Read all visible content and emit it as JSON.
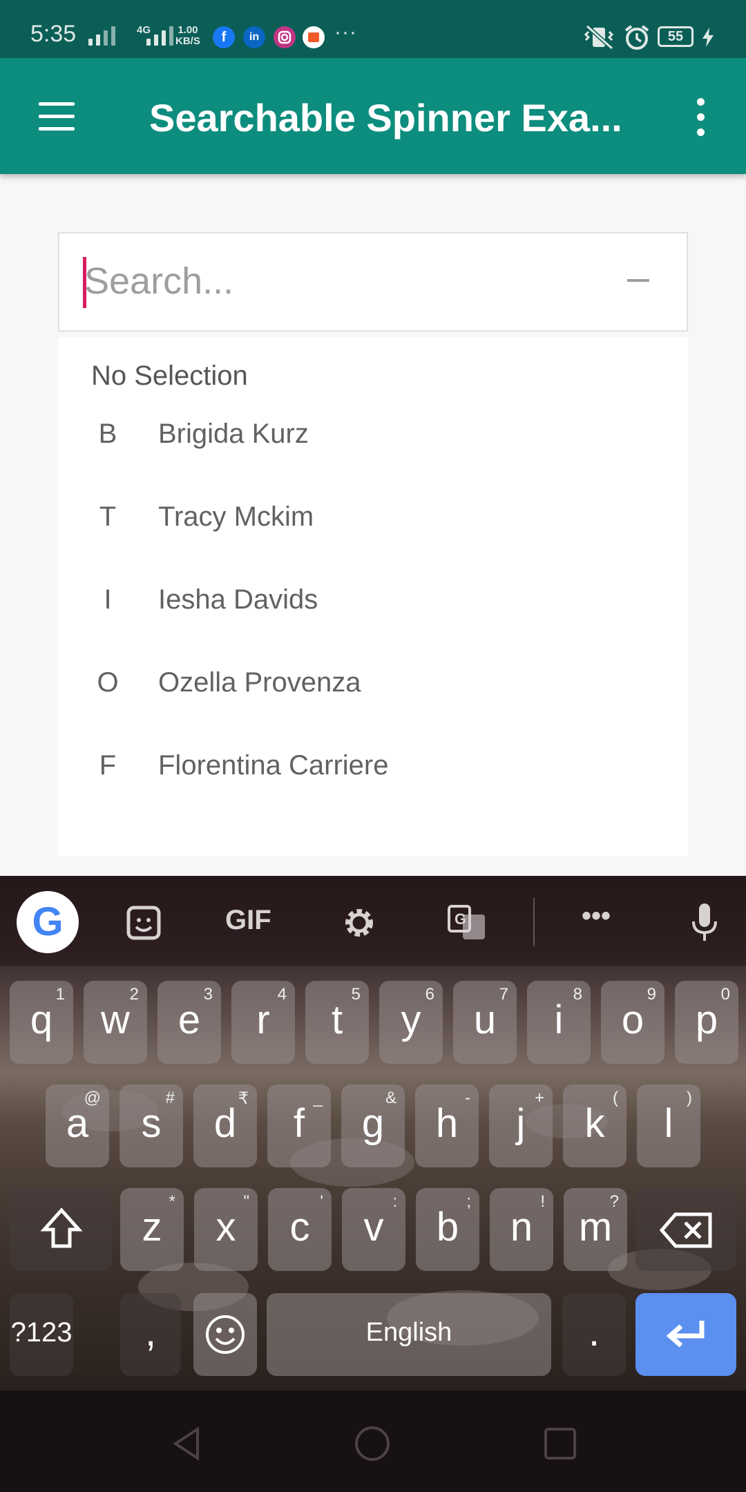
{
  "status_bar": {
    "time": "5:35",
    "network": "4G",
    "speed_value": "1.00",
    "speed_unit": "KB/S",
    "more_notifications": "···",
    "battery_level": "55",
    "app_icons": [
      "facebook-icon",
      "linkedin-icon",
      "instagram-icon",
      "news-icon"
    ]
  },
  "toolbar": {
    "title": "Searchable Spinner Exa...",
    "background": "#0d8d7e"
  },
  "search": {
    "placeholder": "Search...",
    "value": ""
  },
  "list": {
    "no_selection": "No Selection",
    "items": [
      {
        "initial": "B",
        "name": "Brigida Kurz"
      },
      {
        "initial": "T",
        "name": "Tracy Mckim"
      },
      {
        "initial": "I",
        "name": "Iesha Davids"
      },
      {
        "initial": "O",
        "name": "Ozella Provenza"
      },
      {
        "initial": "F",
        "name": "Florentina Carriere"
      }
    ]
  },
  "keyboard": {
    "toolbar": {
      "google": "G",
      "gif": "GIF",
      "more": "•••"
    },
    "row1": [
      {
        "k": "q",
        "h": "1"
      },
      {
        "k": "w",
        "h": "2"
      },
      {
        "k": "e",
        "h": "3"
      },
      {
        "k": "r",
        "h": "4"
      },
      {
        "k": "t",
        "h": "5"
      },
      {
        "k": "y",
        "h": "6"
      },
      {
        "k": "u",
        "h": "7"
      },
      {
        "k": "i",
        "h": "8"
      },
      {
        "k": "o",
        "h": "9"
      },
      {
        "k": "p",
        "h": "0"
      }
    ],
    "row2": [
      {
        "k": "a",
        "h": "@"
      },
      {
        "k": "s",
        "h": "#"
      },
      {
        "k": "d",
        "h": "₹"
      },
      {
        "k": "f",
        "h": "_"
      },
      {
        "k": "g",
        "h": "&"
      },
      {
        "k": "h",
        "h": "-"
      },
      {
        "k": "j",
        "h": "+"
      },
      {
        "k": "k",
        "h": "("
      },
      {
        "k": "l",
        "h": ")"
      }
    ],
    "row3": [
      {
        "k": "z",
        "h": "*"
      },
      {
        "k": "x",
        "h": "\""
      },
      {
        "k": "c",
        "h": "'"
      },
      {
        "k": "v",
        "h": ":"
      },
      {
        "k": "b",
        "h": ";"
      },
      {
        "k": "n",
        "h": "!"
      },
      {
        "k": "m",
        "h": "?"
      }
    ],
    "symbols_key": "?123",
    "comma_key": ",",
    "space_label": "English",
    "period_key": ".",
    "accent_color": "#5b8ff0"
  },
  "nav_bar": {
    "buttons": [
      "back-icon",
      "home-icon",
      "recents-icon"
    ]
  }
}
